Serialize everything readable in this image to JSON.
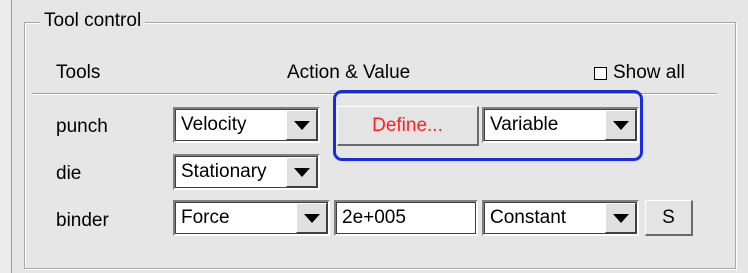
{
  "group": {
    "title": "Tool control"
  },
  "header": {
    "tools": "Tools",
    "action_value": "Action & Value",
    "show_all": "Show all",
    "show_all_checked": false
  },
  "rows": [
    {
      "label": "punch",
      "action": "Velocity",
      "define_label": "Define...",
      "mode": "Variable"
    },
    {
      "label": "die",
      "action": "Stationary"
    },
    {
      "label": "binder",
      "action": "Force",
      "value": "2e+005",
      "mode": "Constant",
      "s_label": "S"
    }
  ],
  "colors": {
    "define_text": "#ff2020",
    "highlight": "#1a2ce0"
  }
}
